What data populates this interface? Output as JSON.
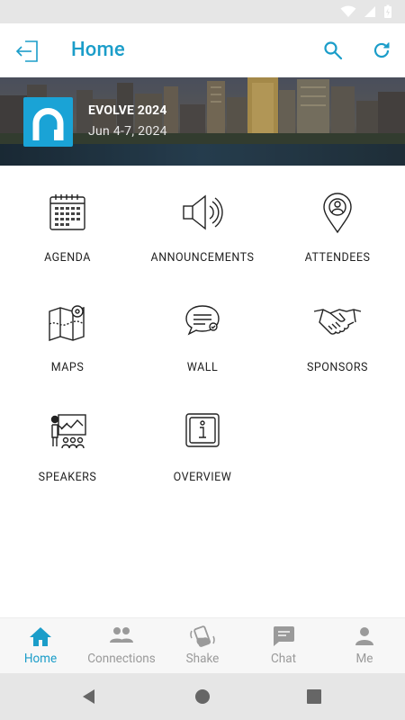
{
  "app": {
    "title": "Home"
  },
  "event": {
    "name": "EVOLVE 2024",
    "dates": "Jun 4-7, 2024"
  },
  "grid": [
    {
      "key": "agenda",
      "label": "AGENDA"
    },
    {
      "key": "announcements",
      "label": "ANNOUNCEMENTS"
    },
    {
      "key": "attendees",
      "label": "ATTENDEES"
    },
    {
      "key": "maps",
      "label": "MAPS"
    },
    {
      "key": "wall",
      "label": "WALL"
    },
    {
      "key": "sponsors",
      "label": "SPONSORS"
    },
    {
      "key": "speakers",
      "label": "SPEAKERS"
    },
    {
      "key": "overview",
      "label": "OVERVIEW"
    }
  ],
  "bottom_nav": [
    {
      "label": "Home",
      "active": true
    },
    {
      "label": "Connections",
      "active": false
    },
    {
      "label": "Shake",
      "active": false
    },
    {
      "label": "Chat",
      "active": false
    },
    {
      "label": "Me",
      "active": false
    }
  ],
  "colors": {
    "accent": "#1b9dc9",
    "inactive": "#9a9a9a",
    "logo": "#1aa3d6"
  }
}
